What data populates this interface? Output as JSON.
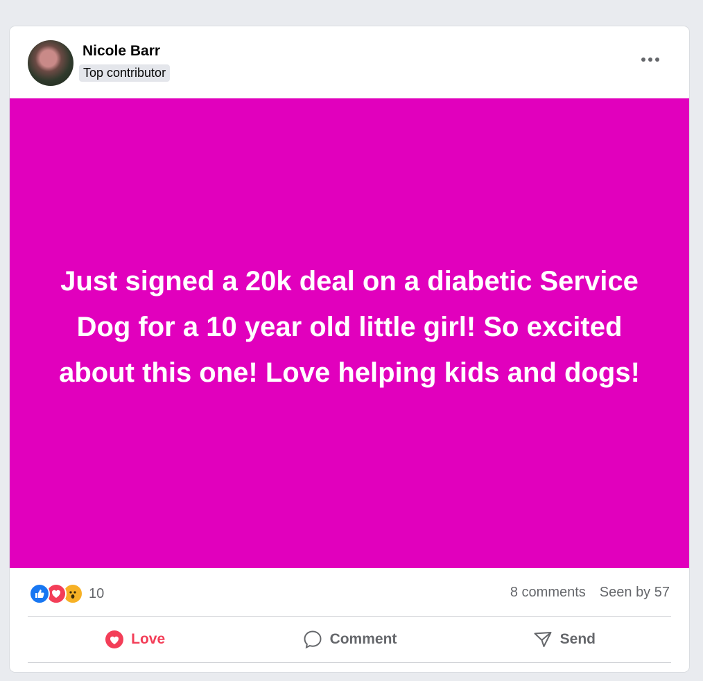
{
  "post": {
    "author": {
      "name": "Nicole Barr",
      "badge": "Top contributor"
    },
    "background_color": "#e100bd",
    "text": "Just signed a 20k deal on a diabetic Service Dog for a 10 year old little girl! So excited about this one! Love helping kids and dogs!"
  },
  "stats": {
    "reaction_icons": [
      "like-icon",
      "love-icon",
      "wow-icon"
    ],
    "reaction_count": "10",
    "comments": "8 comments",
    "seen_by": "Seen by 57"
  },
  "actions": {
    "love_label": "Love",
    "comment_label": "Comment",
    "send_label": "Send"
  },
  "colors": {
    "love": "#f33e58",
    "like": "#1877f2",
    "wow": "#f7b125",
    "muted_text": "#65676b"
  }
}
